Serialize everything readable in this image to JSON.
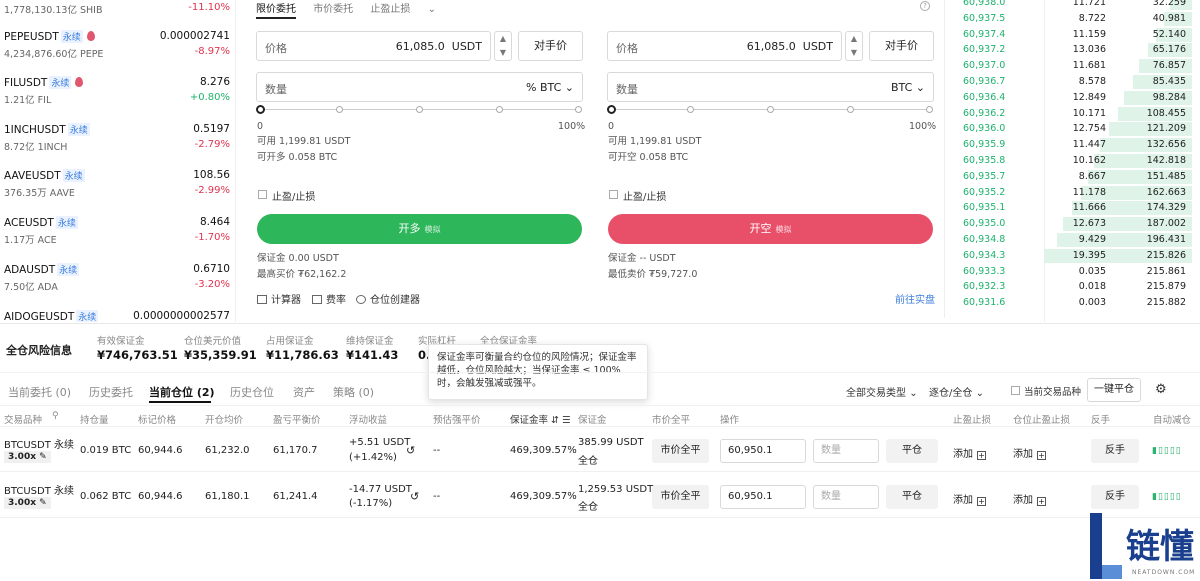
{
  "markets": [
    {
      "name": "",
      "tag": "",
      "fire": false,
      "volume": "1,778,130.13亿 SHIB",
      "price": "",
      "change": "-11.10%",
      "dir": "down"
    },
    {
      "name": "PEPEUSDT",
      "tag": "永续",
      "fire": true,
      "volume": "4,234,876.60亿 PEPE",
      "price": "0.000002741",
      "change": "-8.97%",
      "dir": "down"
    },
    {
      "name": "FILUSDT",
      "tag": "永续",
      "fire": true,
      "volume": "1.21亿 FIL",
      "price": "8.276",
      "change": "+0.80%",
      "dir": "up"
    },
    {
      "name": "1INCHUSDT",
      "tag": "永续",
      "fire": false,
      "volume": "8.72亿 1INCH",
      "price": "0.5197",
      "change": "-2.79%",
      "dir": "down"
    },
    {
      "name": "AAVEUSDT",
      "tag": "永续",
      "fire": false,
      "volume": "376.35万 AAVE",
      "price": "108.56",
      "change": "-2.99%",
      "dir": "down"
    },
    {
      "name": "ACEUSDT",
      "tag": "永续",
      "fire": false,
      "volume": "1.17万 ACE",
      "price": "8.464",
      "change": "-1.70%",
      "dir": "down"
    },
    {
      "name": "ADAUSDT",
      "tag": "永续",
      "fire": false,
      "volume": "7.50亿 ADA",
      "price": "0.6710",
      "change": "-3.20%",
      "dir": "down"
    },
    {
      "name": "AIDOGEUSDT",
      "tag": "永续",
      "fire": false,
      "volume": "",
      "price": "0.0000000002577",
      "change": "",
      "dir": "down"
    }
  ],
  "order": {
    "tabs": [
      "限价委托",
      "市价委托",
      "止盈止损"
    ],
    "left": {
      "price_label": "价格",
      "price_value": "61,085.0",
      "price_unit": "USDT",
      "counter_label": "对手价",
      "qty_label": "数量",
      "qty_unit": "% BTC",
      "pct_start": "0",
      "pct_end": "100%",
      "available": "可用 1,199.81 USDT",
      "can_open": "可开多 0.058 BTC",
      "tpsl_label": "止盈/止损",
      "action_label": "开多",
      "action_sub": "模拟",
      "margin": "保证金 0.00 USDT",
      "limit_price": "最高买价 ₮62,162.2"
    },
    "right": {
      "price_label": "价格",
      "price_value": "61,085.0",
      "price_unit": "USDT",
      "counter_label": "对手价",
      "qty_label": "数量",
      "qty_unit": "BTC",
      "pct_start": "0",
      "pct_end": "100%",
      "available": "可用 1,199.81 USDT",
      "can_open": "可开空 0.058 BTC",
      "tpsl_label": "止盈/止损",
      "action_label": "开空",
      "action_sub": "模拟",
      "margin": "保证金 -- USDT",
      "limit_price": "最低卖价 ₮59,727.0"
    },
    "tools": [
      "计算器",
      "费率",
      "仓位创建器"
    ],
    "go_live": "前往实盘"
  },
  "orderbook": [
    {
      "price": "60,938.0",
      "size": "11.721",
      "total": "32.259",
      "depth": 0.15
    },
    {
      "price": "60,937.5",
      "size": "8.722",
      "total": "40.981",
      "depth": 0.19
    },
    {
      "price": "60,937.4",
      "size": "11.159",
      "total": "52.140",
      "depth": 0.24
    },
    {
      "price": "60,937.2",
      "size": "13.036",
      "total": "65.176",
      "depth": 0.3
    },
    {
      "price": "60,937.0",
      "size": "11.681",
      "total": "76.857",
      "depth": 0.36
    },
    {
      "price": "60,936.7",
      "size": "8.578",
      "total": "85.435",
      "depth": 0.4
    },
    {
      "price": "60,936.4",
      "size": "12.849",
      "total": "98.284",
      "depth": 0.46
    },
    {
      "price": "60,936.2",
      "size": "10.171",
      "total": "108.455",
      "depth": 0.5
    },
    {
      "price": "60,936.0",
      "size": "12.754",
      "total": "121.209",
      "depth": 0.56
    },
    {
      "price": "60,935.9",
      "size": "11.447",
      "total": "132.656",
      "depth": 0.62
    },
    {
      "price": "60,935.8",
      "size": "10.162",
      "total": "142.818",
      "depth": 0.66
    },
    {
      "price": "60,935.7",
      "size": "8.667",
      "total": "151.485",
      "depth": 0.7
    },
    {
      "price": "60,935.2",
      "size": "11.178",
      "total": "162.663",
      "depth": 0.75
    },
    {
      "price": "60,935.1",
      "size": "11.666",
      "total": "174.329",
      "depth": 0.81
    },
    {
      "price": "60,935.0",
      "size": "12.673",
      "total": "187.002",
      "depth": 0.87
    },
    {
      "price": "60,934.8",
      "size": "9.429",
      "total": "196.431",
      "depth": 0.91
    },
    {
      "price": "60,934.3",
      "size": "19.395",
      "total": "215.826",
      "depth": 1.0
    },
    {
      "price": "60,933.3",
      "size": "0.035",
      "total": "215.861",
      "depth": 0.0
    },
    {
      "price": "60,932.3",
      "size": "0.018",
      "total": "215.879",
      "depth": 0.0
    },
    {
      "price": "60,931.6",
      "size": "0.003",
      "total": "215.882",
      "depth": 0.0
    }
  ],
  "risk": {
    "title": "全仓风险信息",
    "cells": [
      {
        "label": "有效保证金",
        "value": "¥746,763.51"
      },
      {
        "label": "仓位美元价值",
        "value": "¥35,359.91"
      },
      {
        "label": "占用保证金",
        "value": "¥11,786.63"
      },
      {
        "label": "维持保证金",
        "value": "¥141.43"
      },
      {
        "label": "实际杠杆",
        "value": "0."
      },
      {
        "label": "全仓保证金率",
        "value": ""
      }
    ]
  },
  "tooltip": "保证金率可衡量合约仓位的风险情况；保证金率越低，仓位风险越大；当保证金率 ≤ 100% 时，会触发强减或强平。",
  "positions_tabs": [
    "当前委托 (0)",
    "历史委托",
    "当前仓位 (2)",
    "历史仓位",
    "资产",
    "策略 (0)"
  ],
  "filters": {
    "type": "全部交易类型",
    "mode": "逐仓/全仓",
    "current_only": "当前交易品种",
    "close_all": "一键平仓"
  },
  "table_headers": [
    "交易品种",
    "持仓量",
    "标记价格",
    "开仓均价",
    "盈亏平衡价",
    "浮动收益",
    "预估强平价",
    "保证金率",
    "保证金",
    "市价全平",
    "操作",
    "止盈止损",
    "仓位止盈止损",
    "反手",
    "自动减仓"
  ],
  "positions": [
    {
      "symbol": "BTCUSDT 永续",
      "leverage": "3.00x",
      "qty": "0.019 BTC",
      "qty_dir": "down",
      "mark": "60,944.6",
      "entry": "61,232.0",
      "breakeven": "61,170.7",
      "pnl": "+5.51 USDT",
      "pnl_pct": "(+1.42%)",
      "pnl_dir": "up",
      "liq": "--",
      "margin_rate": "469,309.57%",
      "margin": "385.99 USDT",
      "margin_mode": "全仓",
      "market_close": "市价全平",
      "price_input": "60,950.1",
      "qty_placeholder": "数量",
      "close": "平仓",
      "tpsl": "添加",
      "pos_tpsl": "添加",
      "reverse": "反手",
      "auto": "▮▯▯▯▯"
    },
    {
      "symbol": "BTCUSDT 永续",
      "leverage": "3.00x",
      "qty": "0.062 BTC",
      "qty_dir": "up",
      "mark": "60,944.6",
      "entry": "61,180.1",
      "breakeven": "61,241.4",
      "pnl": "-14.77 USDT",
      "pnl_pct": "(-1.17%)",
      "pnl_dir": "down",
      "liq": "--",
      "margin_rate": "469,309.57%",
      "margin": "1,259.53 USDT",
      "margin_mode": "全仓",
      "market_close": "市价全平",
      "price_input": "60,950.1",
      "qty_placeholder": "数量",
      "close": "平仓",
      "tpsl": "添加",
      "pos_tpsl": "添加",
      "reverse": "反手",
      "auto": "▮▯▯▯▯"
    }
  ],
  "logo": {
    "text": "链懂",
    "sub": "NEATDOWN.COM"
  },
  "colors": {
    "green": "#20b26c",
    "red": "#e0334f",
    "long_button": "#2db65a",
    "short_button": "#e8506a",
    "logo_blue": "#1a3f8f"
  }
}
